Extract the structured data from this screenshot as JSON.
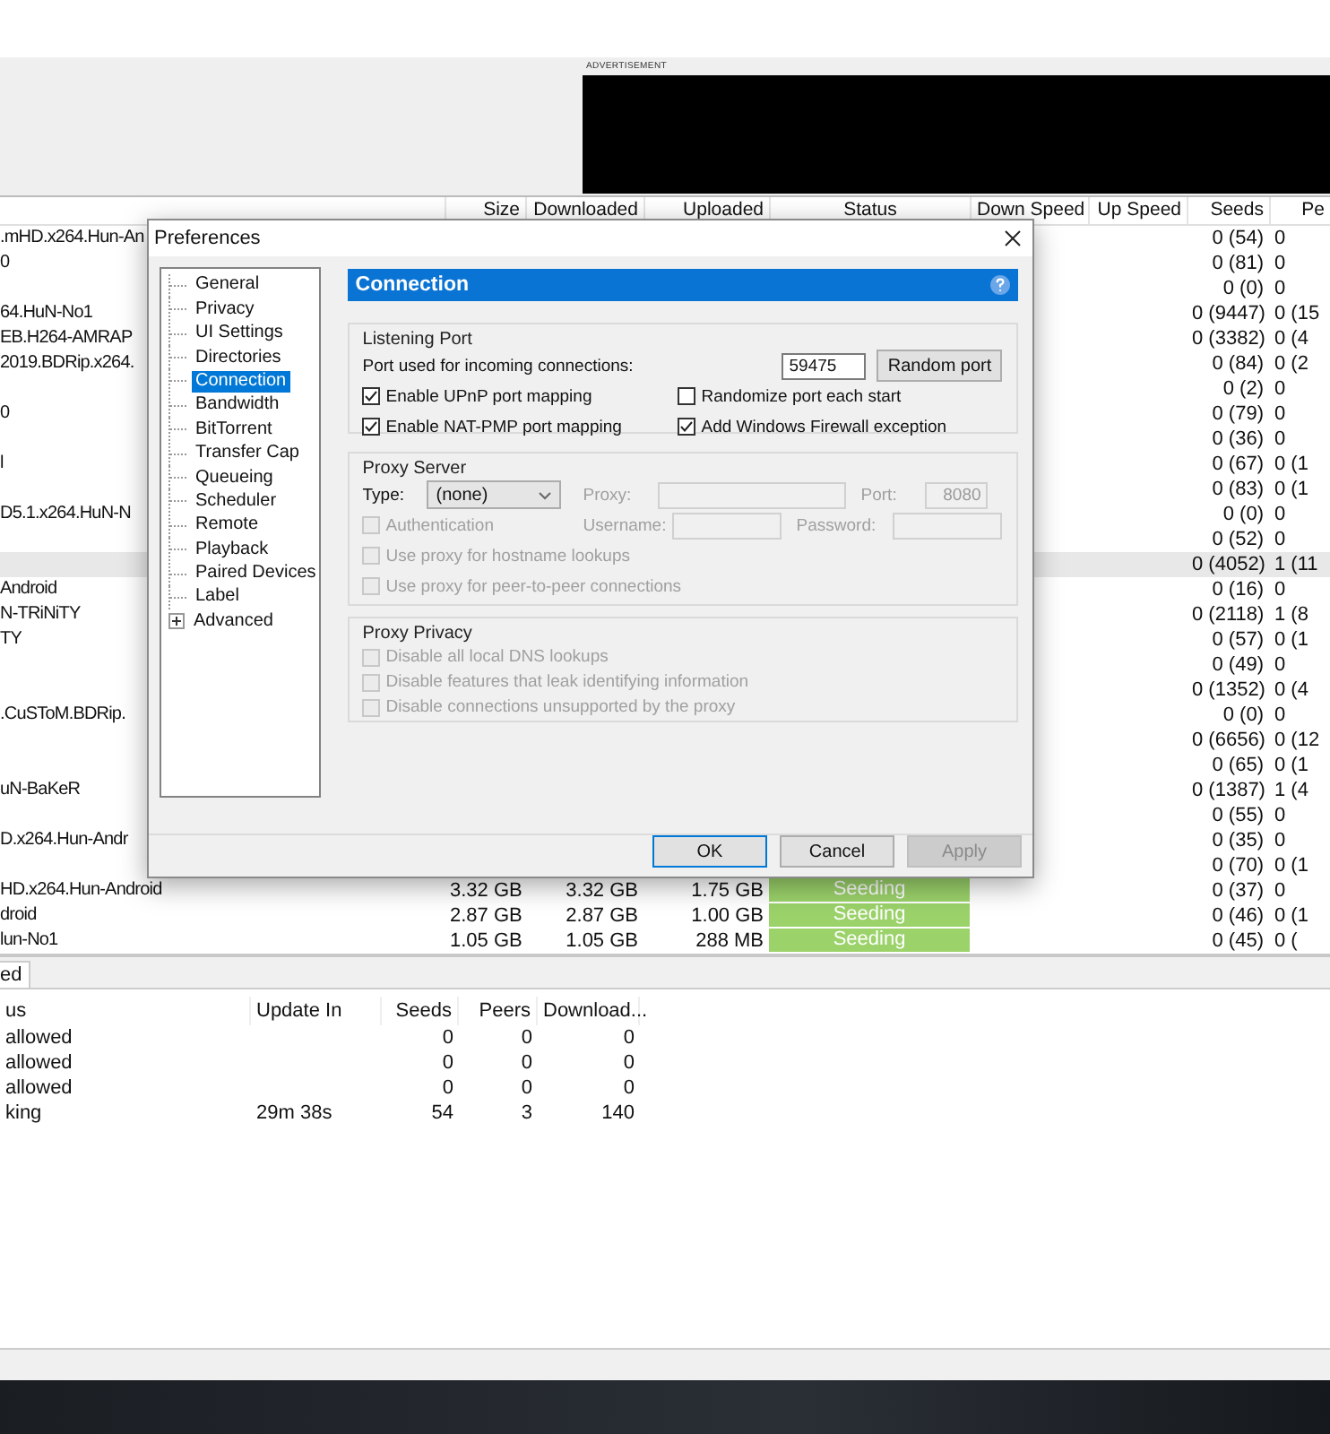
{
  "ad": {
    "label": "ADVERTISEMENT"
  },
  "torrents": {
    "columns": [
      "Size",
      "Downloaded",
      "Uploaded",
      "Status",
      "Down Speed",
      "Up Speed",
      "Seeds",
      "Pe"
    ],
    "rows": [
      {
        "name": ".mHD.x264.Hun-An",
        "seeds": "0 (54)",
        "peers": "0",
        "selected": false
      },
      {
        "name": "0",
        "seeds": "0 (81)",
        "peers": "0",
        "selected": false
      },
      {
        "seeds": "0 (0)",
        "peers": "0",
        "selected": false
      },
      {
        "name": "64.HuN-No1",
        "seeds": "0 (9447)",
        "peers": "0 (15",
        "selected": false
      },
      {
        "name": "EB.H264-AMRAP",
        "seeds": "0 (3382)",
        "peers": "0 (4",
        "selected": false
      },
      {
        "name": "2019.BDRip.x264.",
        "seeds": "0 (84)",
        "peers": "0 (2",
        "selected": false
      },
      {
        "seeds": "0 (2)",
        "peers": "0",
        "selected": false
      },
      {
        "name": "0",
        "seeds": "0 (79)",
        "peers": "0",
        "selected": false
      },
      {
        "seeds": "0 (36)",
        "peers": "0",
        "selected": false
      },
      {
        "name": "l",
        "seeds": "0 (67)",
        "peers": "0 (1",
        "selected": false
      },
      {
        "seeds": "0 (83)",
        "peers": "0 (1",
        "selected": false
      },
      {
        "name": "D5.1.x264.HuN-N",
        "seeds": "0 (0)",
        "peers": "0",
        "selected": false
      },
      {
        "seeds": "0 (52)",
        "peers": "0",
        "selected": false
      },
      {
        "seeds": "0 (4052)",
        "peers": "1 (11",
        "selected": true
      },
      {
        "name": "Android",
        "seeds": "0 (16)",
        "peers": "0",
        "selected": false
      },
      {
        "name": "N-TRiNiTY",
        "seeds": "0 (2118)",
        "peers": "1 (8",
        "selected": false
      },
      {
        "name": "TY",
        "seeds": "0 (57)",
        "peers": "0 (1",
        "selected": false
      },
      {
        "seeds": "0 (49)",
        "peers": "0",
        "selected": false
      },
      {
        "seeds": "0 (1352)",
        "peers": "0 (4",
        "selected": false
      },
      {
        "name": ".CuSToM.BDRip.",
        "seeds": "0 (0)",
        "peers": "0",
        "selected": false
      },
      {
        "seeds": "0 (6656)",
        "peers": "0 (12",
        "selected": false
      },
      {
        "seeds": "0 (65)",
        "peers": "0 (1",
        "selected": false
      },
      {
        "name": "uN-BaKeR",
        "seeds": "0 (1387)",
        "peers": "1 (4",
        "selected": false
      },
      {
        "seeds": "0 (55)",
        "peers": "0",
        "selected": false
      },
      {
        "name": "D.x264.Hun-Andr",
        "seeds": "0 (35)",
        "peers": "0",
        "selected": false
      },
      {
        "seeds": "0 (70)",
        "peers": "0 (1",
        "selected": false
      },
      {
        "name": "HD.x264.Hun-Android",
        "size": "3.32 GB",
        "downloaded": "3.32 GB",
        "uploaded": "1.75 GB",
        "status": "Seeding",
        "seeds": "0 (37)",
        "peers": "0",
        "selected": false
      },
      {
        "name": "droid",
        "size": "2.87 GB",
        "downloaded": "2.87 GB",
        "uploaded": "1.00 GB",
        "status": "Seeding",
        "seeds": "0 (46)",
        "peers": "0 (1",
        "selected": false
      },
      {
        "name": "lun-No1",
        "size": "1.05 GB",
        "downloaded": "1.05 GB",
        "uploaded": "288 MB",
        "status": "Seeding",
        "seeds": "0 (45)",
        "peers": "0 (",
        "selected": false
      }
    ]
  },
  "bottom_panel": {
    "tab": "ed",
    "columns": [
      "us",
      "Update In",
      "Seeds",
      "Peers",
      "Download..."
    ],
    "rows": [
      [
        "allowed",
        "",
        "0",
        "0",
        "0"
      ],
      [
        "allowed",
        "",
        "0",
        "0",
        "0"
      ],
      [
        "allowed",
        "",
        "0",
        "0",
        "0"
      ],
      [
        "king",
        "29m 38s",
        "54",
        "3",
        "140"
      ]
    ]
  },
  "dialog": {
    "title": "Preferences",
    "nav": [
      {
        "label": "General",
        "selected": false,
        "expandable": false
      },
      {
        "label": "Privacy",
        "selected": false,
        "expandable": false
      },
      {
        "label": "UI Settings",
        "selected": false,
        "expandable": false
      },
      {
        "label": "Directories",
        "selected": false,
        "expandable": false
      },
      {
        "label": "Connection",
        "selected": true,
        "expandable": false
      },
      {
        "label": "Bandwidth",
        "selected": false,
        "expandable": false
      },
      {
        "label": "BitTorrent",
        "selected": false,
        "expandable": false
      },
      {
        "label": "Transfer Cap",
        "selected": false,
        "expandable": false
      },
      {
        "label": "Queueing",
        "selected": false,
        "expandable": false
      },
      {
        "label": "Scheduler",
        "selected": false,
        "expandable": false
      },
      {
        "label": "Remote",
        "selected": false,
        "expandable": false
      },
      {
        "label": "Playback",
        "selected": false,
        "expandable": false
      },
      {
        "label": "Paired Devices",
        "selected": false,
        "expandable": false
      },
      {
        "label": "Label",
        "selected": false,
        "expandable": false
      },
      {
        "label": "Advanced",
        "selected": false,
        "expandable": true
      }
    ],
    "section_title": "Connection",
    "listening_port": {
      "title": "Listening Port",
      "port_label": "Port used for incoming connections:",
      "port_value": "59475",
      "random_button": "Random port",
      "options": [
        {
          "label": "Enable UPnP port mapping",
          "checked": true,
          "disabled": false
        },
        {
          "label": "Randomize port each start",
          "checked": false,
          "disabled": false
        },
        {
          "label": "Enable NAT-PMP port mapping",
          "checked": true,
          "disabled": false
        },
        {
          "label": "Add Windows Firewall exception",
          "checked": true,
          "disabled": false
        }
      ]
    },
    "proxy_server": {
      "title": "Proxy Server",
      "type_label": "Type:",
      "type_value": "(none)",
      "proxy_label": "Proxy:",
      "port_label": "Port:",
      "port_value": "8080",
      "username_label": "Username:",
      "password_label": "Password:",
      "auth": {
        "label": "Authentication",
        "checked": false,
        "disabled": true
      },
      "options": [
        {
          "label": "Use proxy for hostname lookups",
          "checked": false,
          "disabled": true
        },
        {
          "label": "Use proxy for peer-to-peer connections",
          "checked": false,
          "disabled": true
        }
      ]
    },
    "proxy_privacy": {
      "title": "Proxy Privacy",
      "options": [
        {
          "label": "Disable all local DNS lookups",
          "checked": false,
          "disabled": true
        },
        {
          "label": "Disable features that leak identifying information",
          "checked": false,
          "disabled": true
        },
        {
          "label": "Disable connections unsupported by the proxy",
          "checked": false,
          "disabled": true
        }
      ]
    },
    "buttons": [
      {
        "label": "OK",
        "kind": "default"
      },
      {
        "label": "Cancel",
        "kind": "normal"
      },
      {
        "label": "Apply",
        "kind": "disabled"
      }
    ]
  }
}
